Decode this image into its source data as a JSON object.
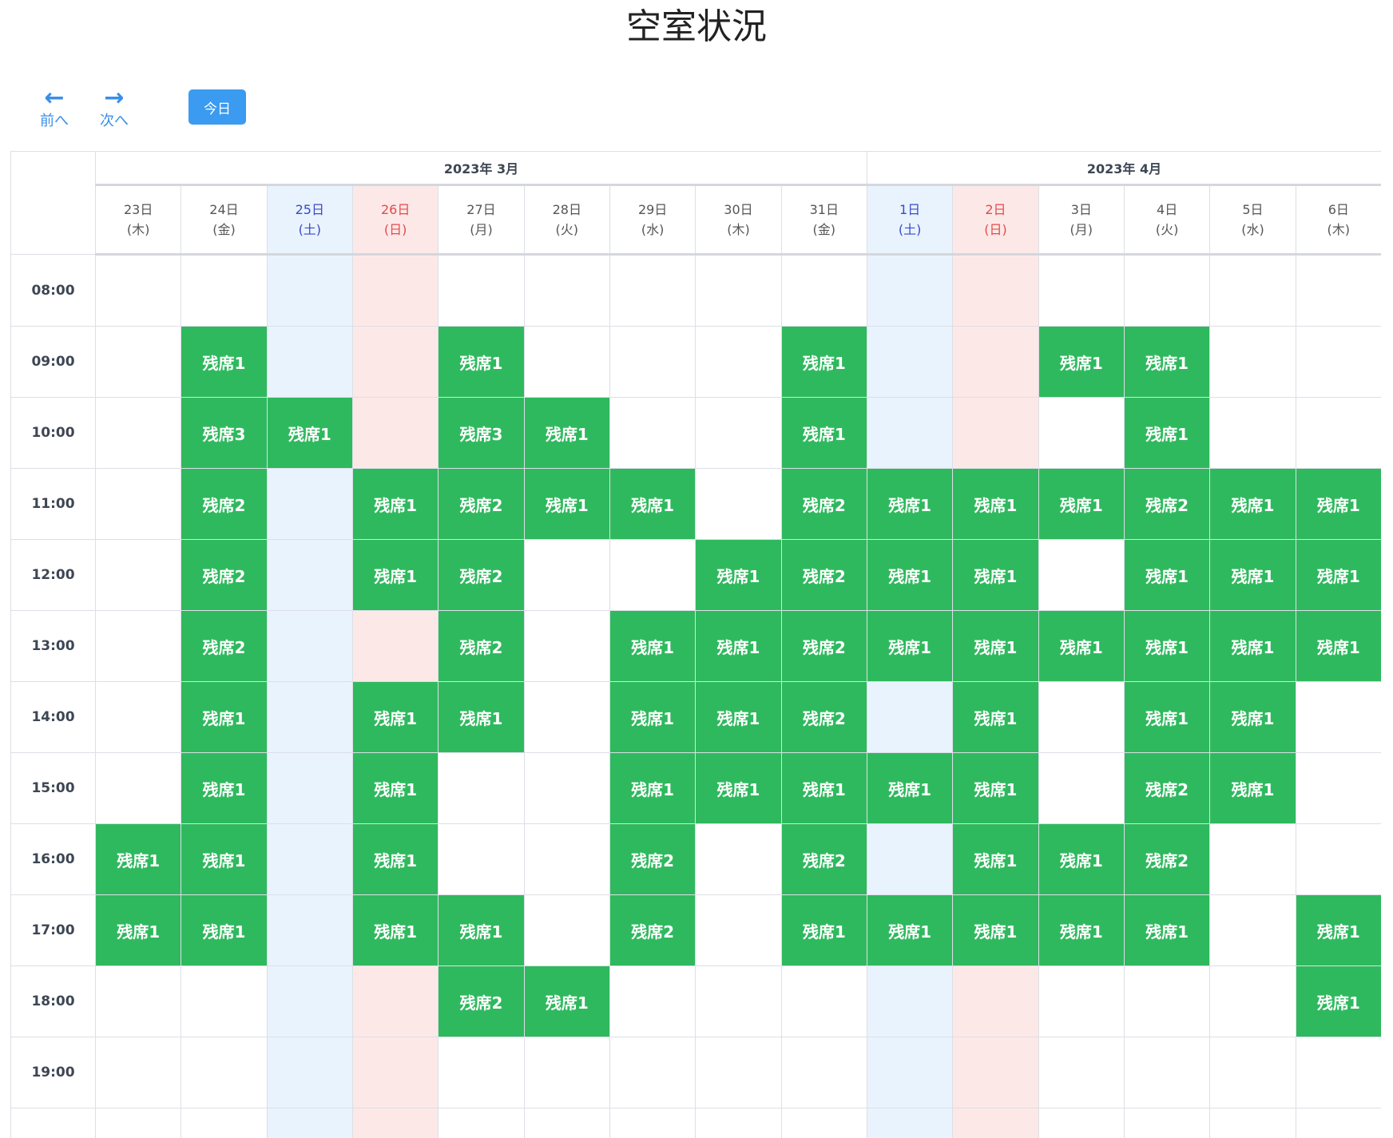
{
  "page": {
    "title": "空室状況"
  },
  "nav": {
    "prev_label": "前へ",
    "next_label": "次へ",
    "today_label": "今日"
  },
  "months": [
    {
      "label": "2023年 3月",
      "span": 9
    },
    {
      "label": "2023年 4月",
      "span": 6
    }
  ],
  "days": [
    {
      "day": "23日",
      "weekday": "(木)",
      "type": "weekday"
    },
    {
      "day": "24日",
      "weekday": "(金)",
      "type": "weekday"
    },
    {
      "day": "25日",
      "weekday": "(土)",
      "type": "sat"
    },
    {
      "day": "26日",
      "weekday": "(日)",
      "type": "sun"
    },
    {
      "day": "27日",
      "weekday": "(月)",
      "type": "weekday"
    },
    {
      "day": "28日",
      "weekday": "(火)",
      "type": "weekday"
    },
    {
      "day": "29日",
      "weekday": "(水)",
      "type": "weekday"
    },
    {
      "day": "30日",
      "weekday": "(木)",
      "type": "weekday"
    },
    {
      "day": "31日",
      "weekday": "(金)",
      "type": "weekday"
    },
    {
      "day": "1日",
      "weekday": "(土)",
      "type": "sat"
    },
    {
      "day": "2日",
      "weekday": "(日)",
      "type": "sun"
    },
    {
      "day": "3日",
      "weekday": "(月)",
      "type": "weekday"
    },
    {
      "day": "4日",
      "weekday": "(火)",
      "type": "weekday"
    },
    {
      "day": "5日",
      "weekday": "(水)",
      "type": "weekday"
    },
    {
      "day": "6日",
      "weekday": "(木)",
      "type": "weekday"
    }
  ],
  "rows": [
    {
      "time": "08:00",
      "slots": [
        "",
        "",
        "",
        "",
        "",
        "",
        "",
        "",
        "",
        "",
        "",
        "",
        "",
        "",
        ""
      ]
    },
    {
      "time": "09:00",
      "slots": [
        "",
        "残席1",
        "",
        "",
        "残席1",
        "",
        "",
        "",
        "残席1",
        "",
        "",
        "残席1",
        "残席1",
        "",
        ""
      ]
    },
    {
      "time": "10:00",
      "slots": [
        "",
        "残席3",
        "残席1",
        "",
        "残席3",
        "残席1",
        "",
        "",
        "残席1",
        "",
        "",
        "",
        "残席1",
        "",
        ""
      ]
    },
    {
      "time": "11:00",
      "slots": [
        "",
        "残席2",
        "",
        "残席1",
        "残席2",
        "残席1",
        "残席1",
        "",
        "残席2",
        "残席1",
        "残席1",
        "残席1",
        "残席2",
        "残席1",
        "残席1"
      ]
    },
    {
      "time": "12:00",
      "slots": [
        "",
        "残席2",
        "",
        "残席1",
        "残席2",
        "",
        "",
        "残席1",
        "残席2",
        "残席1",
        "残席1",
        "",
        "残席1",
        "残席1",
        "残席1"
      ]
    },
    {
      "time": "13:00",
      "slots": [
        "",
        "残席2",
        "",
        "",
        "残席2",
        "",
        "残席1",
        "残席1",
        "残席2",
        "残席1",
        "残席1",
        "残席1",
        "残席1",
        "残席1",
        "残席1"
      ]
    },
    {
      "time": "14:00",
      "slots": [
        "",
        "残席1",
        "",
        "残席1",
        "残席1",
        "",
        "残席1",
        "残席1",
        "残席2",
        "",
        "残席1",
        "",
        "残席1",
        "残席1",
        ""
      ]
    },
    {
      "time": "15:00",
      "slots": [
        "",
        "残席1",
        "",
        "残席1",
        "",
        "",
        "残席1",
        "残席1",
        "残席1",
        "残席1",
        "残席1",
        "",
        "残席2",
        "残席1",
        ""
      ]
    },
    {
      "time": "16:00",
      "slots": [
        "残席1",
        "残席1",
        "",
        "残席1",
        "",
        "",
        "残席2",
        "",
        "残席2",
        "",
        "残席1",
        "残席1",
        "残席2",
        "",
        ""
      ]
    },
    {
      "time": "17:00",
      "slots": [
        "残席1",
        "残席1",
        "",
        "残席1",
        "残席1",
        "",
        "残席2",
        "",
        "残席1",
        "残席1",
        "残席1",
        "残席1",
        "残席1",
        "",
        "残席1"
      ]
    },
    {
      "time": "18:00",
      "slots": [
        "",
        "",
        "",
        "",
        "残席2",
        "残席1",
        "",
        "",
        "",
        "",
        "",
        "",
        "",
        "",
        "残席1"
      ]
    },
    {
      "time": "19:00",
      "slots": [
        "",
        "",
        "",
        "",
        "",
        "",
        "",
        "",
        "",
        "",
        "",
        "",
        "",
        "",
        ""
      ]
    },
    {
      "time": "",
      "slots": [
        "",
        "",
        "",
        "",
        "",
        "",
        "",
        "",
        "",
        "",
        "",
        "",
        "",
        "",
        ""
      ]
    }
  ],
  "colors": {
    "available": "#2fb95e",
    "saturday_bg": "#e8f3fd",
    "sunday_bg": "#fde8e8",
    "saturday_text": "#3b49c9",
    "sunday_text": "#e24a4a",
    "primary": "#3a9bf0"
  }
}
